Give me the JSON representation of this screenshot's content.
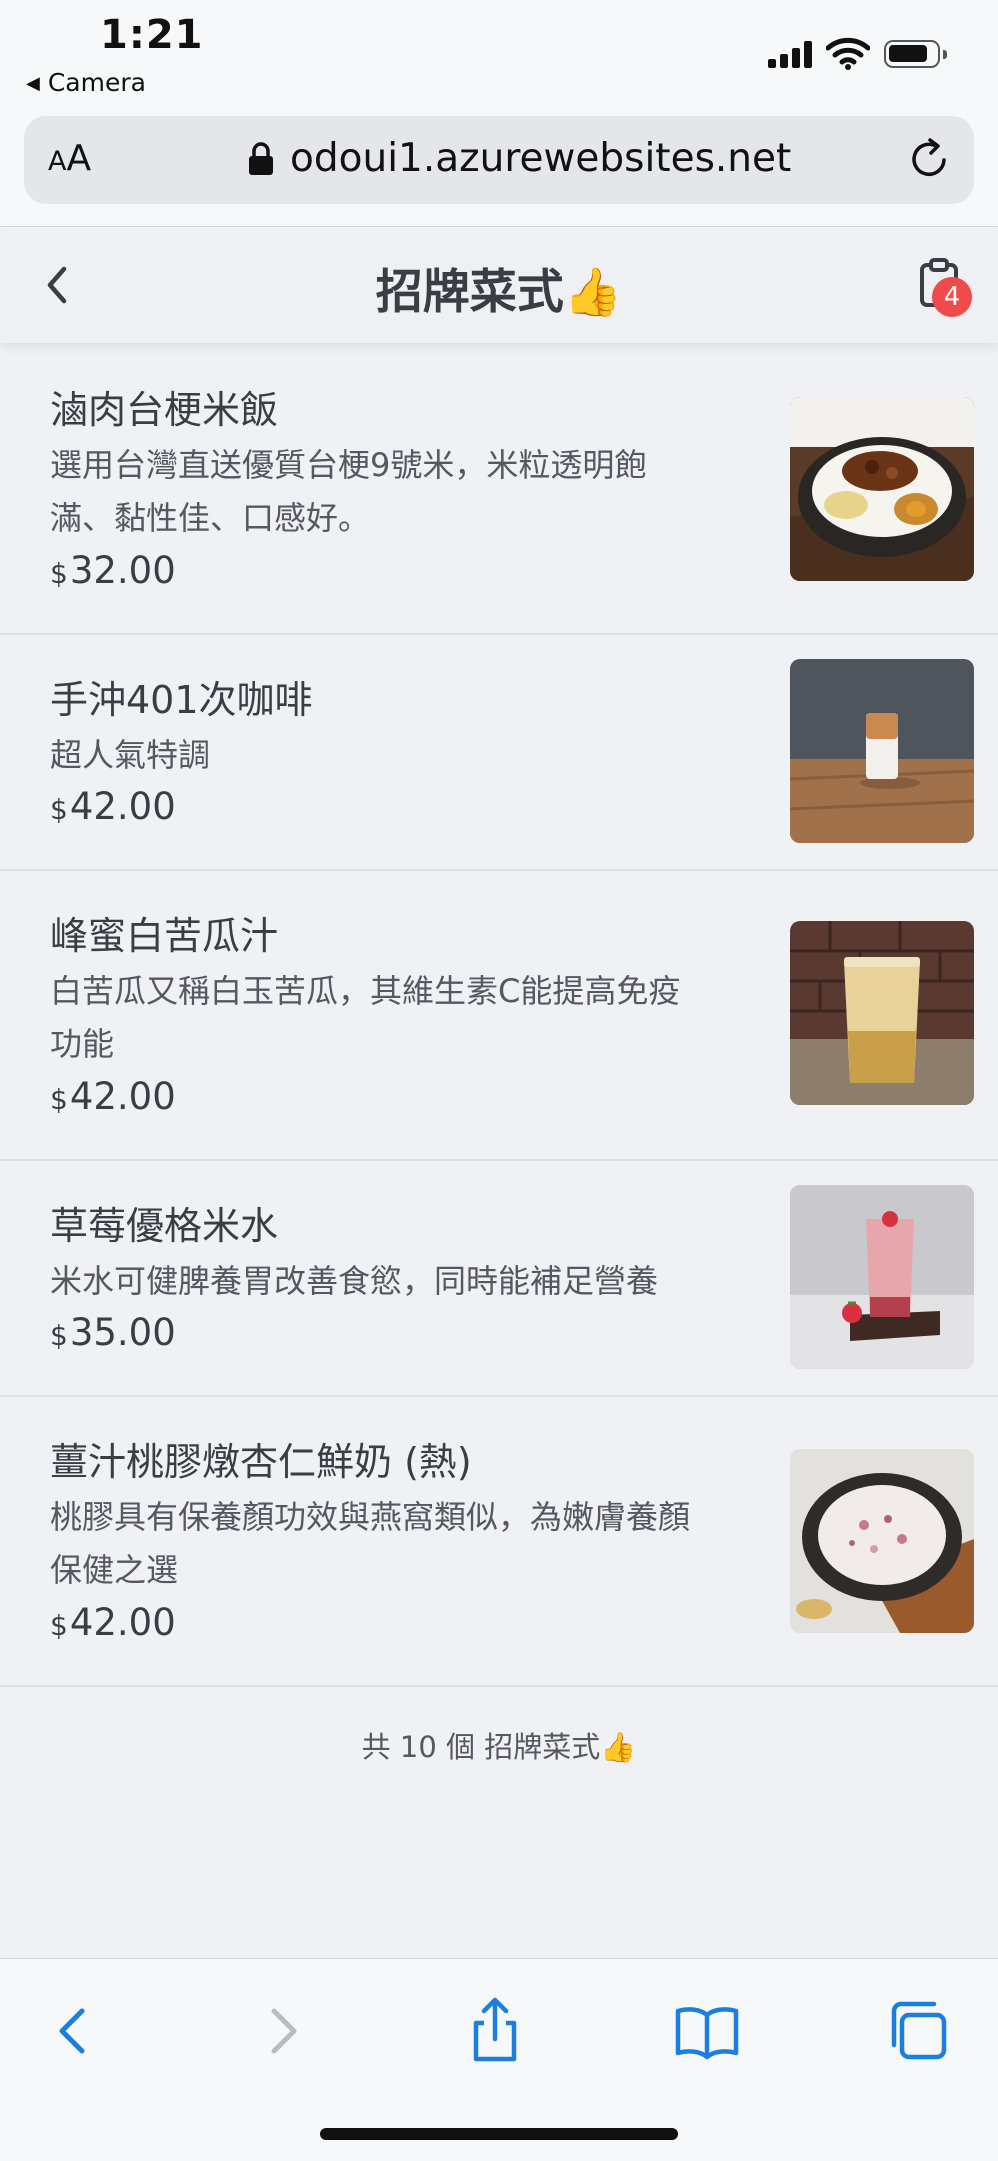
{
  "status_bar": {
    "time": "1:21",
    "back_app": "Camera",
    "back_glyph": "◀"
  },
  "browser": {
    "text_size_label_small": "A",
    "text_size_label_large": "A",
    "url": "odoui1.azurewebsites.net"
  },
  "header": {
    "title": "招牌菜式👍",
    "cart_count": "4"
  },
  "items": [
    {
      "name": "滷肉台梗米飯",
      "desc": "選用台灣直送優質台梗9號米，米粒透明飽滿、黏性佳、口感好。",
      "currency": "$",
      "price": "32.00"
    },
    {
      "name": "手沖401次咖啡",
      "desc": "超人氣特調",
      "currency": "$",
      "price": "42.00"
    },
    {
      "name": "峰蜜白苦瓜汁",
      "desc": "白苦瓜又稱白玉苦瓜，其維生素C能提高免疫功能",
      "currency": "$",
      "price": "42.00"
    },
    {
      "name": "草莓優格米水",
      "desc": "米水可健脾養胃改善食慾，同時能補足營養",
      "currency": "$",
      "price": "35.00"
    },
    {
      "name": "薑汁桃膠燉杏仁鮮奶 (熱)",
      "desc": "桃膠具有保養顏功效與燕窩類似，為嫩膚養顏保健之選",
      "currency": "$",
      "price": "42.00"
    }
  ],
  "footer": {
    "count_text": "共 10 個 招牌菜式👍"
  },
  "colors": {
    "accent": "#1a7fe0",
    "badge": "#ef4b4b",
    "background": "#eff1f4"
  },
  "icons": [
    "signal-icon",
    "wifi-icon",
    "battery-icon",
    "lock-icon",
    "reload-icon",
    "back-chevron-icon",
    "clipboard-cart-icon",
    "back-icon",
    "forward-icon",
    "share-icon",
    "bookmarks-icon",
    "tabs-icon"
  ]
}
